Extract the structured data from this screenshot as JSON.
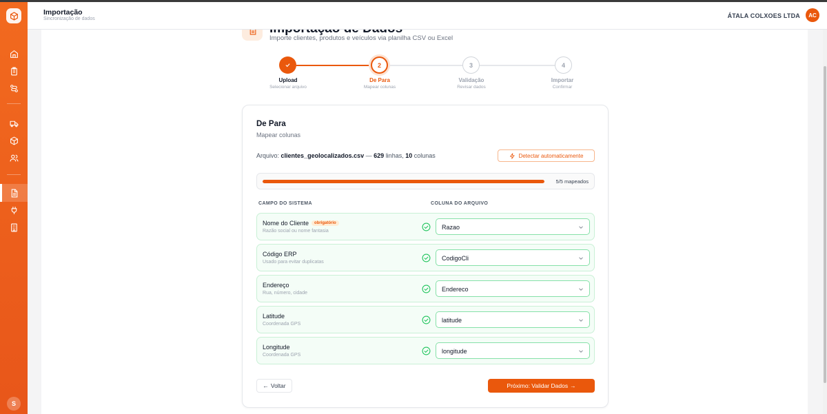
{
  "header": {
    "title": "Importação",
    "subtitle": "Sincronização de dados",
    "company": "ÁTALA COLXOES LTDA",
    "avatar": "AC"
  },
  "sidebar": {
    "user_initial": "S",
    "active_item": "import"
  },
  "page": {
    "title": "Importação de Dados",
    "subtitle": "Importe clientes, produtos e veículos via planilha CSV ou Excel"
  },
  "steps": [
    {
      "number": "1",
      "label": "Upload",
      "desc": "Selecionar arquivo",
      "state": "done"
    },
    {
      "number": "2",
      "label": "De Para",
      "desc": "Mapear colunas",
      "state": "active"
    },
    {
      "number": "3",
      "label": "Validação",
      "desc": "Revisar dados",
      "state": "pending"
    },
    {
      "number": "4",
      "label": "Importar",
      "desc": "Confirmar",
      "state": "pending"
    }
  ],
  "card": {
    "title": "De Para",
    "subtitle": "Mapear colunas",
    "file_prefix": "Arquivo:",
    "file_name": "clientes_geolocalizados.csv",
    "dash": "—",
    "rows_count": "629",
    "rows_label": "linhas,",
    "cols_count": "10",
    "cols_label": "colunas",
    "detect_label": "Detectar automaticamente",
    "progress_text": "5/5 mapeados",
    "progress_fraction": 1.0,
    "col_system": "CAMPO DO SISTEMA",
    "col_file": "COLUNA DO ARQUIVO",
    "back_label": "Voltar",
    "next_label": "Próximo: Validar Dados"
  },
  "mappings": [
    {
      "name": "Nome do Cliente",
      "badge": "obrigatório",
      "desc": "Razão social ou nome fantasia",
      "value": "Razao"
    },
    {
      "name": "Código ERP",
      "badge": "",
      "desc": "Usado para evitar duplicatas",
      "value": "CodigoCli"
    },
    {
      "name": "Endereço",
      "badge": "",
      "desc": "Rua, número, cidade",
      "value": "Endereco"
    },
    {
      "name": "Latitude",
      "badge": "",
      "desc": "Coordenada GPS",
      "value": "latitude"
    },
    {
      "name": "Longitude",
      "badge": "",
      "desc": "Coordenada GPS",
      "value": "longitude"
    }
  ],
  "colors": {
    "accent": "#ea580c",
    "success": "#22c55e"
  }
}
